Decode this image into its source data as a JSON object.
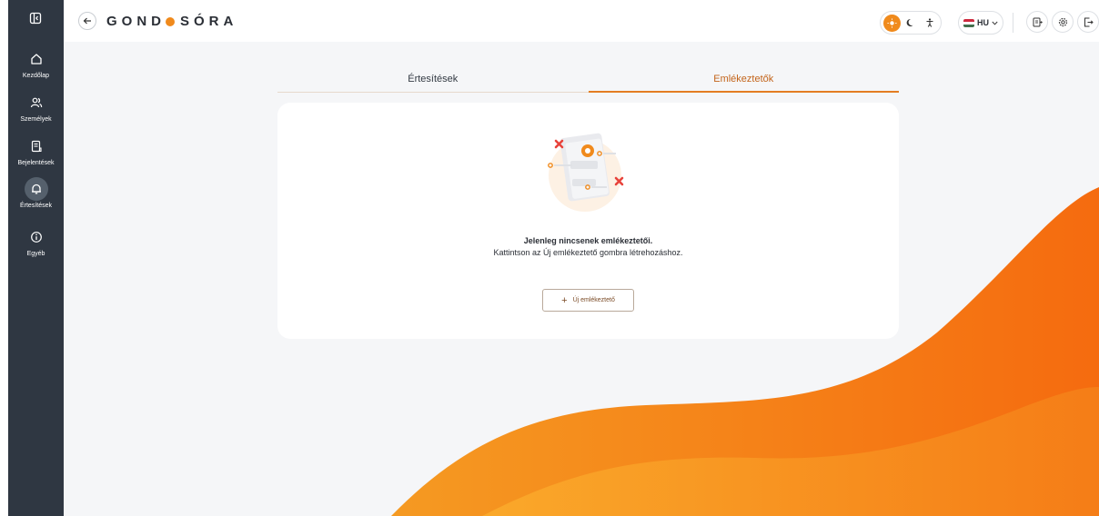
{
  "sidebar": {
    "collapse_icon": "sidebar-collapse-icon",
    "items": [
      {
        "label": "Kezdőlap",
        "icon": "home-icon"
      },
      {
        "label": "Személyek",
        "icon": "people-icon"
      },
      {
        "label": "Bejelentések",
        "icon": "document-icon"
      },
      {
        "label": "Értesítések",
        "icon": "bell-icon",
        "active": true
      },
      {
        "label": "Egyéb",
        "icon": "info-icon"
      }
    ]
  },
  "header": {
    "logo_left": "GOND",
    "logo_right": "SÓRA",
    "language": "HU",
    "theme_modes": [
      "light",
      "dark",
      "accessibility"
    ]
  },
  "tabs": [
    {
      "label": "Értesítések",
      "active": false
    },
    {
      "label": "Emlékeztetők",
      "active": true
    }
  ],
  "empty_state": {
    "title": "Jelenleg nincsenek emlékeztetői.",
    "description": "Kattintson az Új emlékeztető gombra létrehozáshoz.",
    "button_label": "Új emlékeztető"
  },
  "colors": {
    "accent": "#f08a1c",
    "sidebar_bg": "#2f3742",
    "content_bg": "#f5f6f8",
    "error": "#e8433b"
  }
}
